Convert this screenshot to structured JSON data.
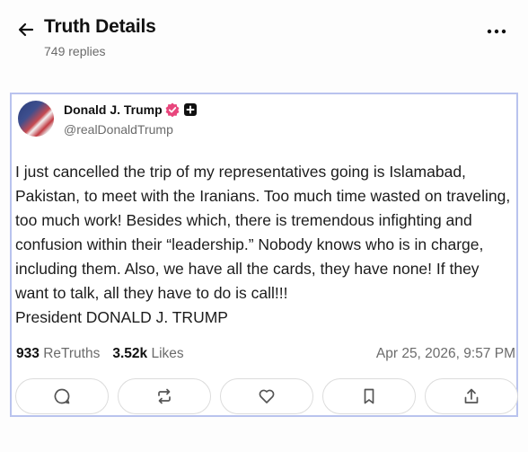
{
  "header": {
    "title": "Truth Details",
    "replies": "749 replies",
    "back_icon": "arrow-left-icon",
    "more_icon": "more-horizontal-icon"
  },
  "post": {
    "display_name": "Donald J. Trump",
    "handle": "@realDonaldTrump",
    "verified_badge_color": "#e8467c",
    "text": "I just cancelled the trip of my representatives going is Islamabad, Pakistan, to meet with the Iranians. Too much time wasted on traveling, too much work! Besides which, there is tremendous infighting and confusion within their “leadership.” Nobody knows who is in charge, including them. Also, we have all the cards, they have none! If they want to talk, all they have to do is call!!!\nPresident DONALD J. TRUMP",
    "retruths_count": "933",
    "retruths_label": "ReTruths",
    "likes_count": "3.52k",
    "likes_label": "Likes",
    "timestamp": "Apr 25, 2026, 9:57 PM"
  },
  "actions": [
    {
      "name": "reply",
      "icon": "comment-icon"
    },
    {
      "name": "retruth",
      "icon": "repost-icon"
    },
    {
      "name": "like",
      "icon": "heart-icon"
    },
    {
      "name": "bookmark",
      "icon": "bookmark-icon"
    },
    {
      "name": "share",
      "icon": "share-icon"
    }
  ],
  "colors": {
    "card_border": "#b9c3ee",
    "muted_text": "#6b6b6b",
    "button_border": "#dcdcdc"
  }
}
